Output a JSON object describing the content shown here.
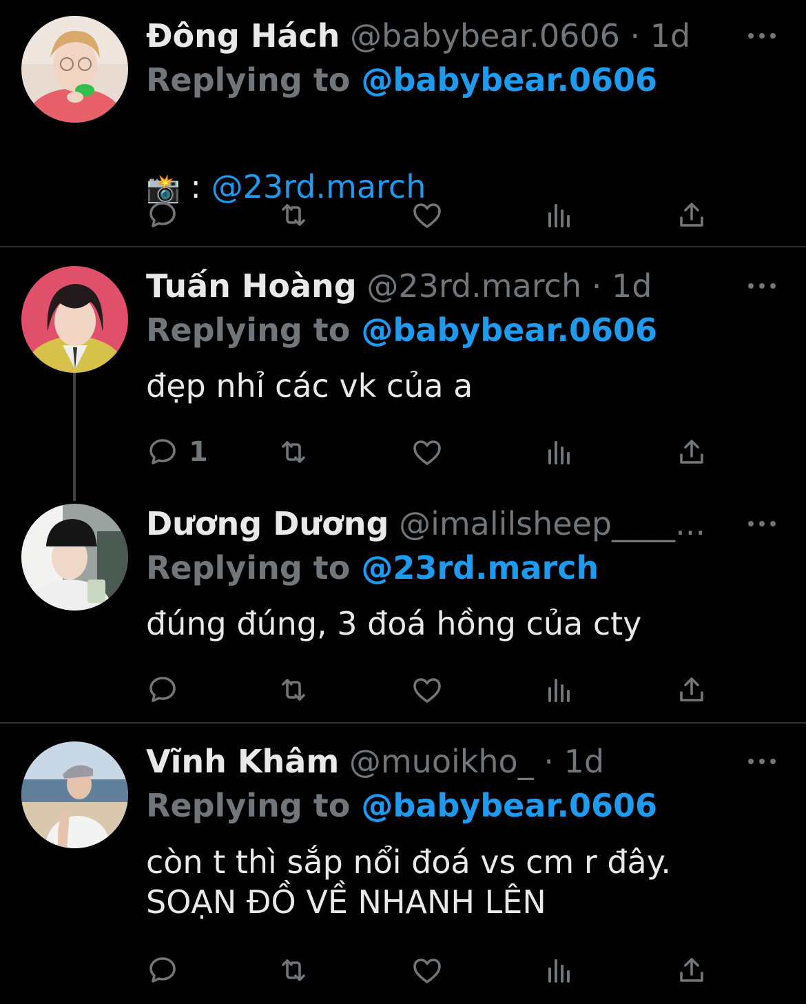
{
  "colors": {
    "background": "#000000",
    "text": "#e7e9ea",
    "muted": "#71767b",
    "accent": "#1d9bf0"
  },
  "tweets": [
    {
      "name": "Đông Hách",
      "handle": "@babybear.0606",
      "dot": "·",
      "time": "1d",
      "reply_label": "Replying to",
      "reply_to": "@babybear.0606",
      "body_prefix_icon": "camera-flash-icon",
      "body_prefix": " : ",
      "body_mention": "@23rd.march",
      "reply_count": ""
    },
    {
      "name": "Tuấn Hoàng",
      "handle": "@23rd.march",
      "dot": "·",
      "time": "1d",
      "reply_label": "Replying to",
      "reply_to": "@babybear.0606",
      "body": "đẹp nhỉ các vk của a",
      "reply_count": "1"
    },
    {
      "name": "Dương Dương",
      "handle": "@imalilsheep____...",
      "reply_label": "Replying to",
      "reply_to": "@23rd.march",
      "body": "đúng đúng, 3 đoá hồng của cty",
      "reply_count": ""
    },
    {
      "name": "Vĩnh Khâm",
      "handle": "@muoikho_",
      "dot": "·",
      "time": "1d",
      "reply_label": "Replying to",
      "reply_to": "@babybear.0606",
      "body": "còn t thì sắp nổi đoá vs cm r đây.\nSOẠN ĐỒ VỀ NHANH LÊN",
      "reply_count": ""
    }
  ],
  "icons": {
    "reply": "reply-icon",
    "retweet": "retweet-icon",
    "like": "heart-icon",
    "views": "views-chart-icon",
    "share": "share-icon",
    "more": "more-dots-icon"
  }
}
